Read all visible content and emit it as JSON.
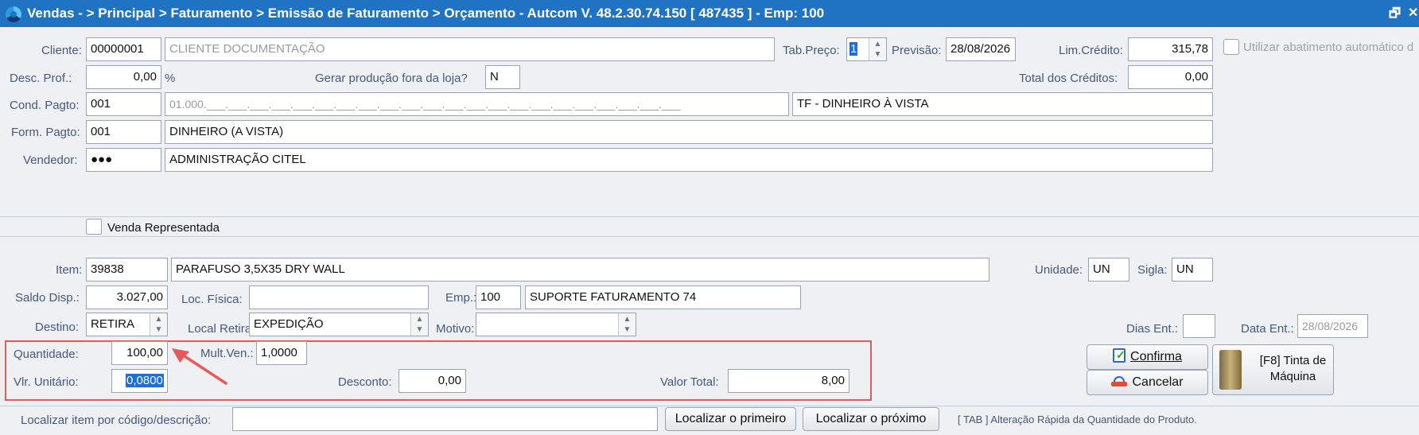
{
  "window": {
    "title": "Vendas -  > Principal > Faturamento > Emissão de Faturamento > Orçamento   -   Autcom V. 48.2.30.74.150 [ 487435 ] - Emp: 100",
    "restore_glyph": "🗗",
    "close_glyph": "✕"
  },
  "header": {
    "cliente_label": "Cliente:",
    "cliente_code": "00000001",
    "cliente_name": "CLIENTE DOCUMENTAÇÃO",
    "tab_preco_label": "Tab.Preço:",
    "tab_preco_value": "1",
    "previsao_label": "Previsão:",
    "previsao_value": "28/08/2026",
    "lim_credito_label": "Lim.Crédito:",
    "lim_credito_value": "315,78",
    "abatimento_label": "Utilizar abatimento automático d",
    "desc_prof_label": "Desc. Prof.:",
    "desc_prof_value": "0,00",
    "percent_label": "%",
    "gerar_producao_label": "Gerar produção fora da loja?",
    "gerar_producao_value": "N",
    "total_creditos_label": "Total dos Créditos:",
    "total_creditos_value": "0,00",
    "cond_pagto_label": "Cond. Pagto:",
    "cond_pagto_code": "001",
    "cond_pagto_mask": "01.000.___.___.___.___.___.___.___.___.___.___.___.___.___.___.___.___.___.___.___.___.___.___",
    "cond_pagto_desc": "TF - DINHEIRO À VISTA",
    "form_pagto_label": "Form. Pagto:",
    "form_pagto_code": "001",
    "form_pagto_desc": "DINHEIRO (A VISTA)",
    "vendedor_label": "Vendedor:",
    "vendedor_code": "●●●",
    "vendedor_name": "ADMINISTRAÇÃO CITEL",
    "venda_representada_label": "Venda Representada"
  },
  "item": {
    "item_label": "Item:",
    "item_code": "39838",
    "item_desc": "PARAFUSO 3,5X35 DRY WALL",
    "unidade_label": "Unidade:",
    "unidade_value": "UN",
    "sigla_label": "Sigla:",
    "sigla_value": "UN",
    "saldo_label": "Saldo Disp.:",
    "saldo_value": "3.027,00",
    "loc_fisica_label": "Loc. Física:",
    "loc_fisica_value": "",
    "emp_label": "Emp.:",
    "emp_code": "100",
    "emp_desc": "SUPORTE FATURAMENTO 74",
    "destino_label": "Destino:",
    "destino_value": "RETIRA",
    "local_retira_label": "Local Retira:",
    "local_retira_value": "EXPEDIÇÃO",
    "motivo_label": "Motivo:",
    "motivo_value": "",
    "dias_ent_label": "Dias Ent.:",
    "dias_ent_value": "",
    "data_ent_label": "Data Ent.:",
    "data_ent_value": "28/08/2026",
    "quantidade_label": "Quantidade:",
    "quantidade_value": "100,00",
    "mult_ven_label": "Mult.Ven.:",
    "mult_ven_value": "1,0000",
    "vlr_unitario_label": "Vlr. Unitário:",
    "vlr_unitario_value": "0,0800",
    "desconto_label": "Desconto:",
    "desconto_value": "0,00",
    "valor_total_label": "Valor Total:",
    "valor_total_value": "8,00"
  },
  "actions": {
    "confirma_label": "Confirma",
    "cancelar_label": "Cancelar",
    "tinta_label_line1": "[F8] Tinta de",
    "tinta_label_line2": "Máquina"
  },
  "search": {
    "label": "Localizar item por código/descrição:",
    "value": "",
    "find_first_label": "Localizar o primeiro",
    "find_next_label": "Localizar o próximo",
    "hint": "[ TAB ] Alteração Rápida da Quantidade do Produto."
  },
  "colors": {
    "titlebar": "#1f73c2",
    "highlight_box": "#e8595a",
    "selection": "#1d6fd6"
  }
}
